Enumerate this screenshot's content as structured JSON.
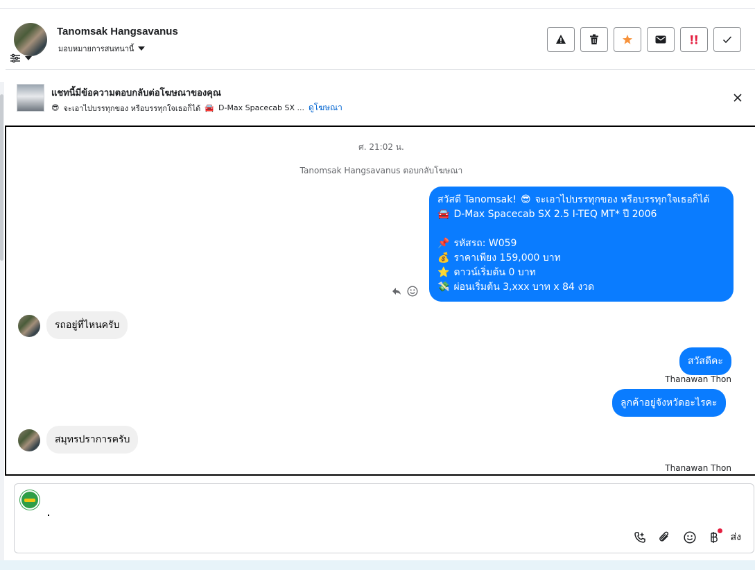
{
  "header": {
    "contact_name": "Tanomsak Hangsavanus",
    "assign_label": "มอบหมายการสนทนานี้",
    "actions": [
      "warning-icon",
      "trash-icon",
      "star-icon",
      "envelope-icon",
      "spam-icon",
      "check-icon"
    ],
    "star_color": "#f7923b",
    "spam_color": "#e41e3f"
  },
  "ad_banner": {
    "title": "แชทนี้มีข้อความตอบกลับต่อโฆษณาของคุณ",
    "subtitle": "จะเอาไปบรรทุกของ หรือบรรทุกใจเธอก็ได้",
    "car": "D-Max Spacecab SX ...",
    "link": "ดูโฆษณา"
  },
  "chat": {
    "timestamp": "ศ. 21:02 น.",
    "ad_reply_note": "Tanomsak Hangsavanus ตอบกลับโฆษณา",
    "ad_message": {
      "l1": "สวัสดี Tanomsak!",
      "l1b": "จะเอาไปบรรทุกของ หรือบรรทุกใจเธอก็ได้",
      "l2": "D-Max Spacecab SX 2.5 I-TEQ MT* ปี 2006",
      "l3": "รหัสรถ: W059",
      "l4": "ราคาเพียง 159,000 บาท",
      "l5": "ดาวน์เริ่มต้น 0 บาท",
      "l6": "ผ่อนเริ่มต้น 3,xxx บาท x 84 งวด"
    },
    "in_msg_1": "รถอยู่ที่ไหนครับ",
    "out_msg_1": "สวัสดีคะ",
    "sender_1": "Thanawan Thon",
    "out_msg_2": "ลูกค้าอยู่จังหวัดอะไรคะ",
    "in_msg_2": "สมุทรปราการครับ",
    "sender_2": "Thanawan Thon",
    "accent": "#0a7cff"
  },
  "composer": {
    "send_label": "ส่ง",
    "tools": [
      "call-add-icon",
      "attachment-icon",
      "emoji-icon",
      "baht-icon"
    ]
  }
}
